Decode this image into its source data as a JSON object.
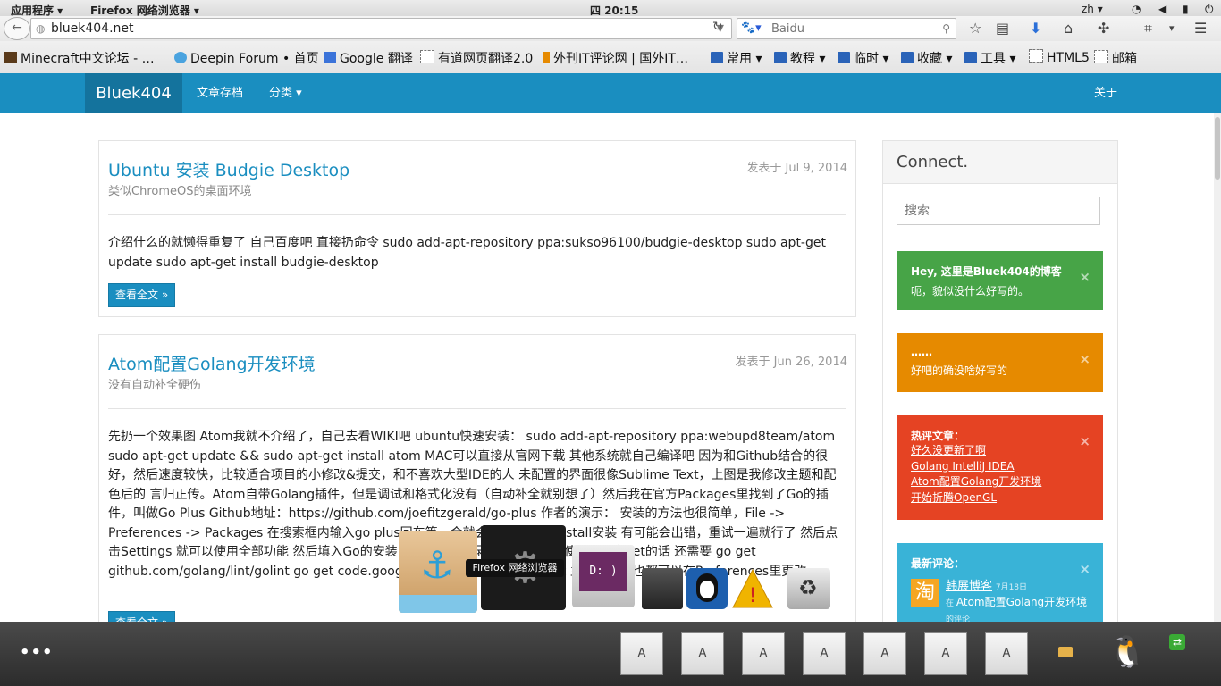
{
  "system_panel": {
    "apps_menu": "应用程序 ▾",
    "active_app": "Firefox 网络浏览器 ▾",
    "clock": "四 20:15",
    "lang": "zh ▾"
  },
  "browser": {
    "url": "bluek404.net",
    "search_engine": "Baidu",
    "search_placeholder": "Baidu"
  },
  "bookmarks": [
    {
      "label": "Minecraft中文论坛 - …",
      "icon": "minecraft-icon"
    },
    {
      "label": "Deepin Forum • 首页",
      "icon": "deepin-icon"
    },
    {
      "label": "Google 翻译",
      "icon": "google-icon"
    },
    {
      "label": "有道网页翻译2.0",
      "icon": "page-icon"
    },
    {
      "label": "外刊IT评论网 | 国外IT…",
      "icon": "bookmark-icon"
    },
    {
      "label": "常用 ▾",
      "icon": "folder-icon"
    },
    {
      "label": "教程 ▾",
      "icon": "folder-icon"
    },
    {
      "label": "临时 ▾",
      "icon": "folder-icon"
    },
    {
      "label": "收藏 ▾",
      "icon": "folder-icon"
    },
    {
      "label": "工具 ▾",
      "icon": "folder-icon"
    },
    {
      "label": "HTML5",
      "icon": "page-icon"
    },
    {
      "label": "邮箱",
      "icon": "page-icon"
    }
  ],
  "site_nav": {
    "brand": "Bluek404",
    "archive": "文章存档",
    "categories": "分类 ▾",
    "about": "关于"
  },
  "posts": [
    {
      "title": "Ubuntu 安装 Budgie Desktop",
      "subtitle": "类似ChromeOS的桌面环境",
      "date": "发表于 Jul 9, 2014",
      "body": "介绍什么的就懒得重复了 自己百度吧 直接扔命令 sudo add-apt-repository ppa:sukso96100/budgie-desktop sudo apt-get update sudo apt-get install budgie-desktop",
      "read_more": "查看全文 »"
    },
    {
      "title": "Atom配置Golang开发环境",
      "subtitle": "没有自动补全硬伤",
      "date": "发表于 Jun 26, 2014",
      "body": "先扔一个效果图 Atom我就不介绍了，自己去看WIKI吧 ubuntu快速安装： sudo add-apt-repository ppa:webupd8team/atom sudo apt-get update && sudo apt-get install atom MAC可以直接从官网下载 其他系统就自己编译吧 因为和Github结合的很好，然后速度较快，比较适合项目的小修改&提交，和不喜欢大型IDE的人 未配置的界面很像Sublime Text，上图是我修改主题和配色后的 言归正传。Atom自带Golang插件，但是调试和格式化没有（自动补全就别想了）然后我在官方Packages里找到了Go的插件，叫做Go Plus Github地址：https://github.com/joefitzgerald/go-plus 作者的演示： 安装的方法也很简单，File -> Preferences -> Packages 在搜索框内输入go plus回车等一会就会出现了 点击Install安装 有可能会出错，重试一遍就行了 然后点击Settings 就可以使用全部功能 然后填入Go的安装目录和工作目录就行了 如果要使用Lint和Vet的话 还需要 go get github.com/golang/lint/golint go get code.google.com/p/go.tools/cmd/vet 主题和配色也都可以在Preferences里更改",
      "read_more": "查看全文 »"
    }
  ],
  "sidebar": {
    "title": "Connect.",
    "search_placeholder": "搜索",
    "notices": [
      {
        "title": "Hey, 这里是Bluek404的博客",
        "text": "呃，貌似没什么好写的。",
        "close": "×"
      },
      {
        "title": "……",
        "text": "好吧的确没啥好写的",
        "close": "×"
      },
      {
        "title": "热评文章：",
        "links": [
          "好久没更新了啊",
          "Golang IntelliJ IDEA",
          "Atom配置Golang开发环境",
          "开始折腾OpenGL"
        ],
        "close": "×"
      },
      {
        "title": "最新评论：",
        "commenter": "韩展博客",
        "comment_meta": "7月18日",
        "comment_post": "Atom配置Golang开发环境",
        "comment_tail": "的评论",
        "close": "×"
      }
    ]
  },
  "dock": {
    "tooltip": "Firefox 网络浏览器"
  },
  "bottom_panel": {
    "menu": "•••",
    "tasks": [
      "A",
      "A",
      "A",
      "A",
      "A",
      "A",
      "A"
    ]
  },
  "colors": {
    "site_nav": "#1a8ec0",
    "brand_bg": "#14739d",
    "green": "#47a447",
    "orange": "#e68a00",
    "red": "#e54323",
    "cyan": "#39b3d7"
  }
}
